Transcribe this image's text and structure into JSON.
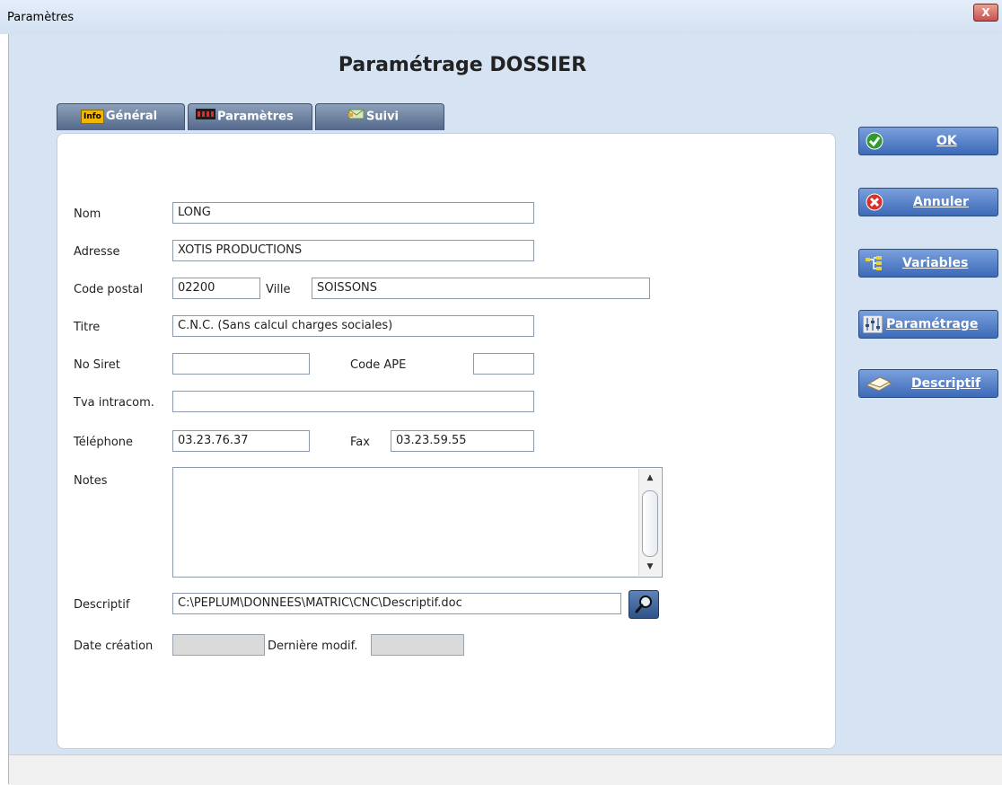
{
  "window": {
    "title": "Paramètres",
    "close_label": "X"
  },
  "page_title": "Paramétrage DOSSIER",
  "tabs": [
    {
      "label": "Général",
      "icon": "info-icon",
      "icon_text": "Info"
    },
    {
      "label": "Paramètres",
      "icon": "settings-icon"
    },
    {
      "label": "Suivi",
      "icon": "mail-icon"
    }
  ],
  "form": {
    "nom_label": "Nom",
    "nom_value": "LONG",
    "adresse_label": "Adresse",
    "adresse_value": "XOTIS PRODUCTIONS",
    "code_postal_label": "Code postal",
    "code_postal_value": "02200",
    "ville_label": "Ville",
    "ville_value": "SOISSONS",
    "titre_label": "Titre",
    "titre_value": "C.N.C. (Sans calcul charges sociales)",
    "siret_label": "No Siret",
    "siret_value": "",
    "ape_label": "Code APE",
    "ape_value": "",
    "tva_label": "Tva intracom.",
    "tva_value": "",
    "telephone_label": "Téléphone",
    "telephone_value": "03.23.76.37",
    "fax_label": "Fax",
    "fax_value": "03.23.59.55",
    "notes_label": "Notes",
    "notes_value": "",
    "descriptif_label": "Descriptif",
    "descriptif_value": "C:\\PEPLUM\\DONNEES\\MATRIC\\CNC\\Descriptif.doc",
    "date_creation_label": "Date création",
    "date_creation_value": "",
    "derniere_modif_label": "Dernière modif.",
    "derniere_modif_value": ""
  },
  "side_buttons": {
    "ok": {
      "label": "OK",
      "icon": "check-icon"
    },
    "annuler": {
      "label": "Annuler",
      "icon": "cancel-icon"
    },
    "variables": {
      "label": "Variables",
      "icon": "tree-icon"
    },
    "parametrage": {
      "label": "Paramétrage",
      "icon": "sliders-icon"
    },
    "descriptif": {
      "label": "Descriptif",
      "icon": "document-icon"
    }
  },
  "colors": {
    "accent": "#3d6ab8",
    "tab": "#52678a",
    "window_bg": "#d6e3f3"
  }
}
